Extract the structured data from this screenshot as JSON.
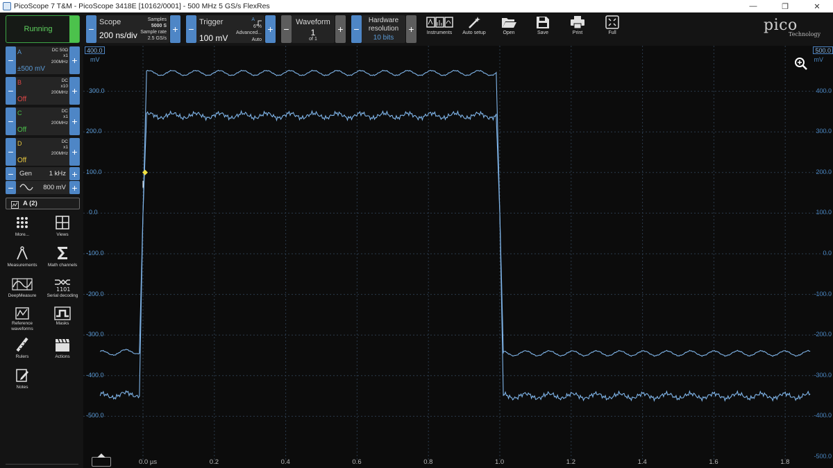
{
  "window": {
    "title": "PicoScope 7 T&M  - PicoScope 3418E [10162/0001] - 500 MHz 5 GS/s FlexRes",
    "minimize": "—",
    "maximize": "❐",
    "close": "✕"
  },
  "toolbar": {
    "run_state": "Running",
    "scope": {
      "label": "Scope",
      "value": "200 ns/div",
      "samples_label": "Samples",
      "samples_value": "5000 S",
      "rate_label": "Sample rate",
      "rate_value": "2.5 GS/s"
    },
    "trigger": {
      "label": "Trigger",
      "value": "100 mV",
      "channel": "A",
      "percent": "6 %",
      "type": "Advanced...",
      "mode": "Auto"
    },
    "waveform": {
      "label": "Waveform",
      "value": "1",
      "of": "of 1"
    },
    "hardware": {
      "label1": "Hardware",
      "label2": "resolution",
      "value": "10 bits"
    },
    "buttons": {
      "instruments": "Instruments",
      "auto_setup": "Auto setup",
      "open": "Open",
      "save": "Save",
      "print": "Print",
      "full": "Full"
    },
    "logo": {
      "brand": "pico",
      "sub": "Technology"
    }
  },
  "channels": [
    {
      "letter": "A",
      "color": "#5a9ad6",
      "coupling": "DC 50Ω",
      "probe": "x1",
      "bandwidth": "200MHz",
      "range": "±500 mV"
    },
    {
      "letter": "B",
      "color": "#e04848",
      "coupling": "DC",
      "probe": "x10",
      "bandwidth": "200MHz",
      "range": "Off"
    },
    {
      "letter": "C",
      "color": "#4cc24c",
      "coupling": "DC",
      "probe": "x1",
      "bandwidth": "200MHz",
      "range": "Off"
    },
    {
      "letter": "D",
      "color": "#e8c840",
      "coupling": "DC",
      "probe": "x1",
      "bandwidth": "200MHz",
      "range": "Off"
    }
  ],
  "generator": {
    "label": "Gen",
    "frequency": "1 kHz",
    "amplitude": "800 mV"
  },
  "view_tab": "A (2)",
  "side_tools": {
    "more": "More...",
    "views": "Views",
    "measurements": "Measurements",
    "math": "Math channels",
    "deepmeasure": "DeepMeasure",
    "serial": "Serial decoding",
    "reference1": "Reference",
    "reference2": "waveforms",
    "masks": "Masks",
    "rulers": "Rulers",
    "actions": "Actions",
    "notes": "Notes"
  },
  "scope_view": {
    "left_axis_top": "400.0",
    "left_unit": "mV",
    "left_ticks": [
      "300.0",
      "200.0",
      "100.0",
      "0.0",
      "-100.0",
      "-200.0",
      "-300.0",
      "-400.0",
      "-500.0"
    ],
    "right_axis_top": "500.0",
    "right_unit": "mV",
    "right_ticks": [
      "400.0",
      "300.0",
      "200.0",
      "100.0",
      "0.0",
      "-100.0",
      "-200.0",
      "-300.0",
      "-400.0",
      "-500.0"
    ],
    "x_ticks": [
      "0.0 µs",
      "0.2",
      "0.4",
      "0.6",
      "0.8",
      "1.0",
      "1.2",
      "1.4",
      "1.6",
      "1.8"
    ],
    "trace_color": "#7fb4e8",
    "grid_color": "#2b3b4c"
  },
  "chart_data": {
    "type": "line",
    "xlabel": "µs",
    "ylabel": "mV",
    "x_unit": "µs",
    "xlim": [
      -0.12,
      1.87
    ],
    "ylim": [
      -500,
      400
    ],
    "series": [
      {
        "x": [
          -0.12,
          -0.01,
          0.0,
          0.01,
          0.99,
          1.0,
          1.01,
          1.87
        ],
        "y": [
          -345,
          -340,
          0,
          345,
          345,
          0,
          -345,
          -345
        ]
      },
      {
        "x": [
          -0.12,
          -0.01,
          0.0,
          0.01,
          0.99,
          1.0,
          1.01,
          1.87
        ],
        "y": [
          -450,
          -445,
          0,
          240,
          240,
          0,
          -450,
          -450
        ]
      }
    ],
    "trigger_point": {
      "x": 0.0,
      "y": 100
    }
  }
}
